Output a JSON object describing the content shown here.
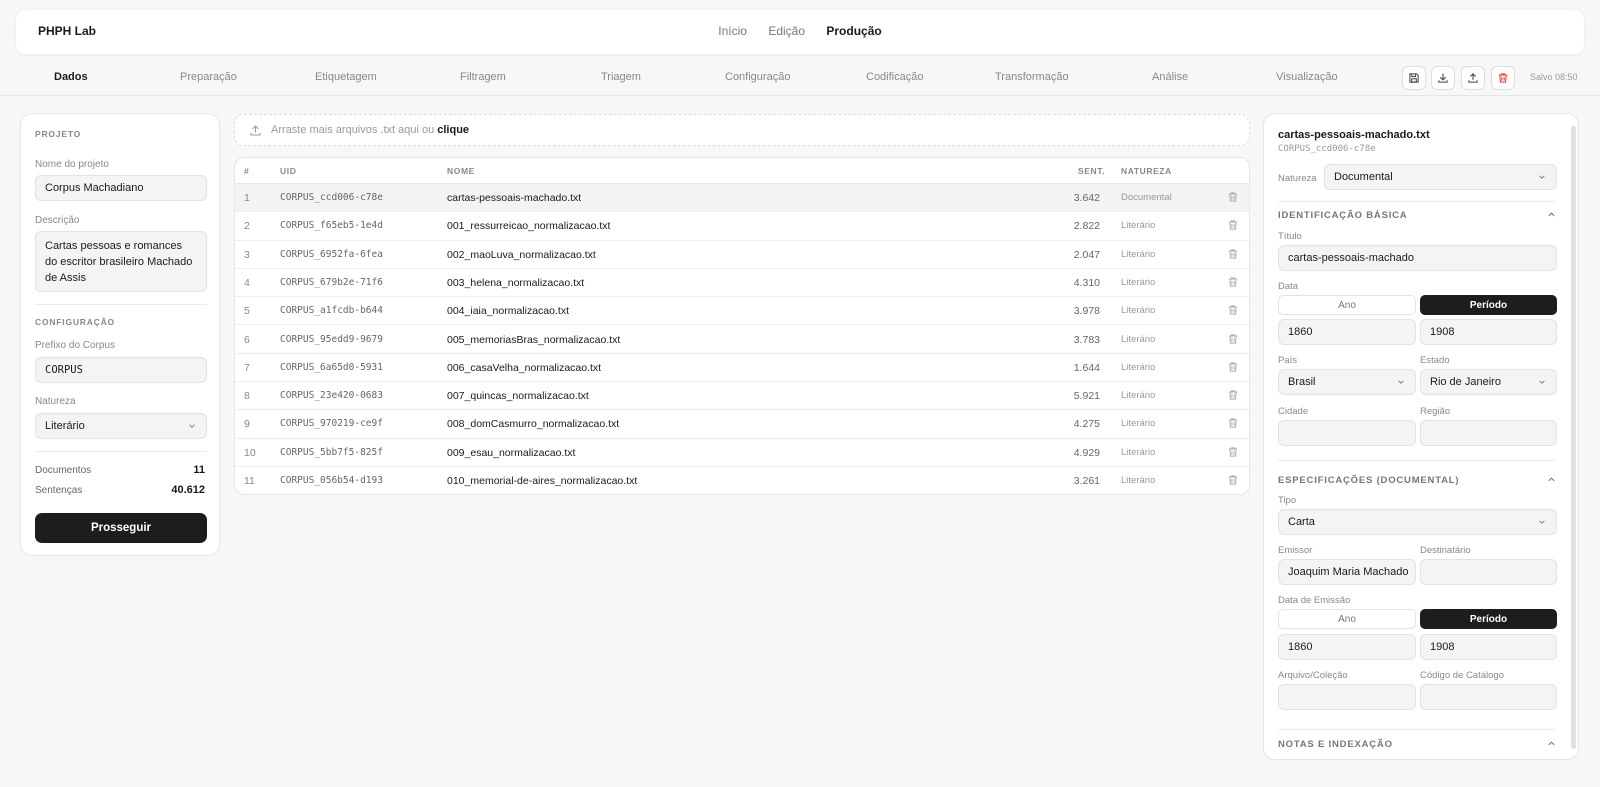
{
  "app": {
    "brand": "PHPH Lab"
  },
  "topnav": [
    {
      "label": "Início",
      "active": false
    },
    {
      "label": "Edição",
      "active": false
    },
    {
      "label": "Produção",
      "active": true
    }
  ],
  "tabs": [
    "Dados",
    "Preparação",
    "Etiquetagem",
    "Filtragem",
    "Triagem",
    "Configuração",
    "Codificação",
    "Transformação",
    "Análise",
    "Visualização"
  ],
  "active_tab": "Dados",
  "toolbar": {
    "icons": [
      "save-icon",
      "download-icon",
      "upload-icon",
      "trash-icon"
    ],
    "saved_label": "Salvo 08:50"
  },
  "left": {
    "project_section": "PROJETO",
    "project_name_label": "Nome do projeto",
    "project_name": "Corpus Machadiano",
    "description_label": "Descrição",
    "description": "Cartas pessoas e romances do escritor brasileiro Machado de Assis",
    "config_section": "CONFIGURAÇÃO",
    "prefix_label": "Prefixo do Corpus",
    "prefix": "CORPUS",
    "nature_label": "Natureza",
    "nature": "Literário",
    "docs_label": "Documentos",
    "docs_value": "11",
    "sentences_label": "Sentenças",
    "sentences_value": "40.612",
    "proceed_button": "Prosseguir"
  },
  "dropzone": {
    "text": "Arraste mais arquivos .txt aqui ou",
    "link": "clique"
  },
  "table": {
    "headers": {
      "num": "#",
      "uid": "UID",
      "name": "NOME",
      "sent": "SENT.",
      "nature": "NATUREZA"
    },
    "rows": [
      {
        "num": "1",
        "uid": "CORPUS_ccd006-c78e",
        "name": "cartas-pessoais-machado.txt",
        "sent": "3.642",
        "nature": "Documental",
        "selected": true
      },
      {
        "num": "2",
        "uid": "CORPUS_f65eb5-1e4d",
        "name": "001_ressurreicao_normalizacao.txt",
        "sent": "2.822",
        "nature": "Literário"
      },
      {
        "num": "3",
        "uid": "CORPUS_6952fa-6fea",
        "name": "002_maoLuva_normalizacao.txt",
        "sent": "2.047",
        "nature": "Literário"
      },
      {
        "num": "4",
        "uid": "CORPUS_679b2e-71f6",
        "name": "003_helena_normalizacao.txt",
        "sent": "4.310",
        "nature": "Literário"
      },
      {
        "num": "5",
        "uid": "CORPUS_a1fcdb-b644",
        "name": "004_iaia_normalizacao.txt",
        "sent": "3.978",
        "nature": "Literário"
      },
      {
        "num": "6",
        "uid": "CORPUS_95edd9-9679",
        "name": "005_memoriasBras_normalizacao.txt",
        "sent": "3.783",
        "nature": "Literário"
      },
      {
        "num": "7",
        "uid": "CORPUS_6a65d0-5931",
        "name": "006_casaVelha_normalizacao.txt",
        "sent": "1.644",
        "nature": "Literário"
      },
      {
        "num": "8",
        "uid": "CORPUS_23e420-0683",
        "name": "007_quincas_normalizacao.txt",
        "sent": "5.921",
        "nature": "Literário"
      },
      {
        "num": "9",
        "uid": "CORPUS_970219-ce9f",
        "name": "008_domCasmurro_normalizacao.txt",
        "sent": "4.275",
        "nature": "Literário"
      },
      {
        "num": "10",
        "uid": "CORPUS_5bb7f5-825f",
        "name": "009_esau_normalizacao.txt",
        "sent": "4.929",
        "nature": "Literário"
      },
      {
        "num": "11",
        "uid": "CORPUS_056b54-d193",
        "name": "010_memorial-de-aires_normalizacao.txt",
        "sent": "3.261",
        "nature": "Literário"
      }
    ]
  },
  "right": {
    "title": "cartas-pessoais-machado.txt",
    "uid": "CORPUS_ccd006-c78e",
    "nature_label": "Natureza",
    "nature": "Documental",
    "basic_section": "IDENTIFICAÇÃO BÁSICA",
    "title_label": "Título",
    "title_value": "cartas-pessoais-machado",
    "date_label": "Data",
    "seg_year": "Ano",
    "seg_period": "Período",
    "date_from": "1860",
    "date_to": "1908",
    "country_label": "País",
    "country": "Brasil",
    "state_label": "Estado",
    "state": "Rio de Janeiro",
    "city_label": "Cidade",
    "city": "",
    "region_label": "Região",
    "region": "",
    "spec_section": "ESPECIFICAÇÕES (DOCUMENTAL)",
    "type_label": "Tipo",
    "type": "Carta",
    "sender_label": "Emissor",
    "sender": "Joaquim Maria Machado",
    "recipient_label": "Destinatário",
    "recipient": "",
    "emission_label": "Data de Emissão",
    "emission_from": "1860",
    "emission_to": "1908",
    "archive_label": "Arquivo/Coleção",
    "archive": "",
    "catalog_label": "Código de Catálogo",
    "catalog": "",
    "notes_section": "NOTAS E INDEXAÇÃO"
  }
}
